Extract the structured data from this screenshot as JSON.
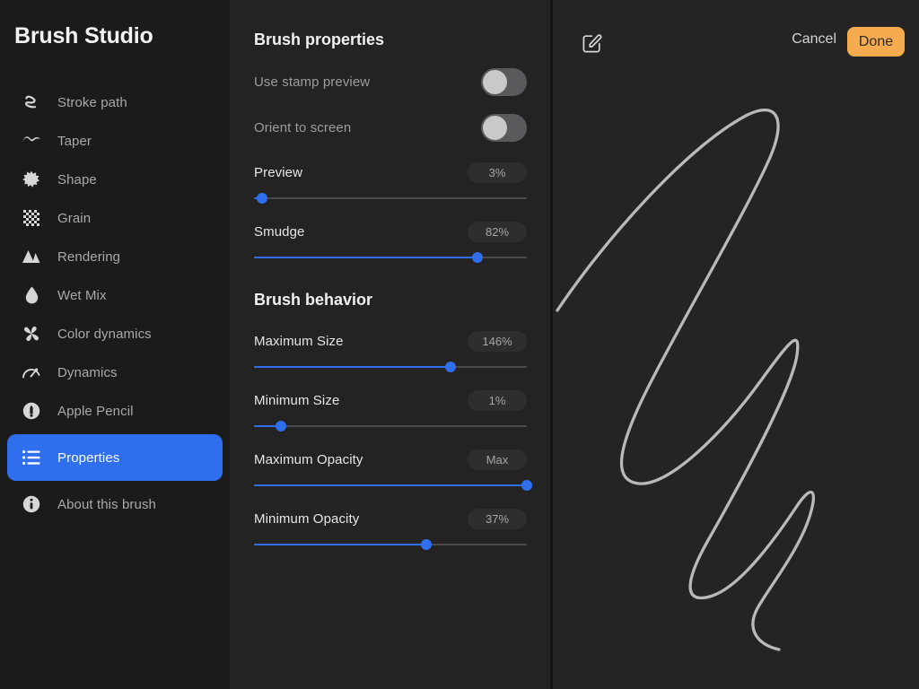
{
  "sidebar": {
    "title": "Brush Studio",
    "items": [
      {
        "label": "Stroke path",
        "icon": "stroke-path-icon",
        "selected": false
      },
      {
        "label": "Taper",
        "icon": "taper-wave-icon",
        "selected": false
      },
      {
        "label": "Shape",
        "icon": "shape-burst-icon",
        "selected": false
      },
      {
        "label": "Grain",
        "icon": "grain-checker-icon",
        "selected": false
      },
      {
        "label": "Rendering",
        "icon": "rendering-icon",
        "selected": false
      },
      {
        "label": "Wet Mix",
        "icon": "droplet-icon",
        "selected": false
      },
      {
        "label": "Color dynamics",
        "icon": "pinwheel-icon",
        "selected": false
      },
      {
        "label": "Dynamics",
        "icon": "speedometer-icon",
        "selected": false
      },
      {
        "label": "Apple Pencil",
        "icon": "pencil-circle-icon",
        "selected": false
      },
      {
        "label": "Properties",
        "icon": "list-lines-icon",
        "selected": true
      },
      {
        "label": "About this brush",
        "icon": "info-circle-icon",
        "selected": false
      }
    ]
  },
  "properties_panel": {
    "sections": [
      {
        "title": "Brush properties",
        "rows": [
          {
            "label": "Use stamp preview",
            "type": "toggle",
            "value": "off"
          },
          {
            "label": "Orient to screen",
            "type": "toggle",
            "value": "off"
          },
          {
            "label": "Preview",
            "type": "slider",
            "value": "3%",
            "percent": 3
          },
          {
            "label": "Smudge",
            "type": "slider",
            "value": "82%",
            "percent": 82
          }
        ]
      },
      {
        "title": "Brush behavior",
        "rows": [
          {
            "label": "Maximum Size",
            "type": "slider",
            "value": "146%",
            "percent": 72
          },
          {
            "label": "Minimum Size",
            "type": "slider",
            "value": "1%",
            "percent": 10
          },
          {
            "label": "Maximum Opacity",
            "type": "slider",
            "value": "Max",
            "percent": 100
          },
          {
            "label": "Minimum Opacity",
            "type": "slider",
            "value": "37%",
            "percent": 63
          }
        ]
      }
    ]
  },
  "preview_panel": {
    "compose_icon": "compose-square-pencil-icon",
    "cancel_label": "Cancel",
    "done_label": "Done",
    "stroke_description": "brush stroke preview scribble"
  },
  "colors": {
    "accent_blue": "#2f6fee",
    "done_amber": "#f5ab4e",
    "sidebar_bg": "#1b1b1b",
    "panel_bg": "#232323",
    "preview_bg": "#242424",
    "stroke_color": "#c9c9c9"
  }
}
